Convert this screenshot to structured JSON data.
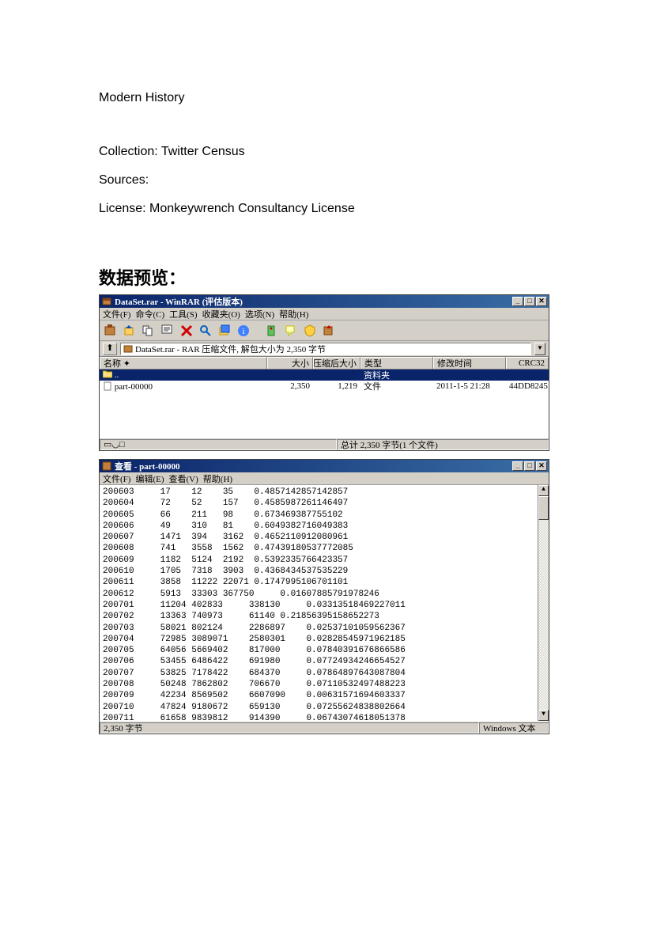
{
  "doc": {
    "title": "Modern History",
    "collection": "Collection: Twitter Census",
    "sources": "Sources:",
    "license": "License: Monkeywrench Consultancy License",
    "preview_heading": "数据预览："
  },
  "winrar": {
    "title": "DataSet.rar - WinRAR (评估版本)",
    "menu": [
      "文件(F)",
      "命令(C)",
      "工具(S)",
      "收藏夹(O)",
      "选项(N)",
      "帮助(H)"
    ],
    "addr": "DataSet.rar - RAR 压缩文件, 解包大小为 2,350 字节",
    "columns": [
      "名称 ✦",
      "大小",
      "压缩后大小",
      "类型",
      "修改时间",
      "CRC32"
    ],
    "rows": [
      {
        "name": "..",
        "size": "",
        "comp": "",
        "type": "资料夹",
        "date": "",
        "crc": "",
        "selected": true,
        "icon": "folder"
      },
      {
        "name": "part-00000",
        "size": "2,350",
        "comp": "1,219",
        "type": "文件",
        "date": "2011-1-5 21:28",
        "crc": "44DD8245",
        "selected": false,
        "icon": "file"
      }
    ],
    "status_left": "▭◡□",
    "status_right": "总计 2,350 字节(1 个文件)"
  },
  "viewer": {
    "title": "查看 - part-00000",
    "menu": [
      "文件(F)",
      "编辑(E)",
      "查看(V)",
      "帮助(H)"
    ],
    "status_left": "2,350 字节",
    "status_right": "Windows 文本",
    "rows": [
      "200603     17    12    35    0.4857142857142857",
      "200604     72    52    157   0.4585987261146497",
      "200605     66    211   98    0.673469387755102",
      "200606     49    310   81    0.6049382716049383",
      "200607     1471  394   3162  0.4652110912080961",
      "200608     741   3558  1562  0.47439180537772085",
      "200609     1182  5124  2192  0.5392335766423357",
      "200610     1705  7318  3903  0.4368434537535229",
      "200611     3858  11222 22071 0.1747995106701101",
      "200612     5913  33303 367750     0.01607885791978246",
      "200701     11204 402833     338130     0.03313518469227011",
      "200702     13363 740973     61140 0.21856395158652273",
      "200703     58021 802124     2286897    0.02537101059562367",
      "200704     72985 3089071    2580301    0.02828545971962185",
      "200705     64056 5669402    817000     0.07840391676866586",
      "200706     53455 6486422    691980     0.07724934246654527",
      "200707     53825 7178422    684370     0.07864897643087804",
      "200708     50248 7862802    706670     0.07110532497488223",
      "200709     42234 8569502    6607090    0.00631571694603337",
      "200710     47824 9180672    659130     0.07255624838802664",
      "200711     61658 9839812    914390     0.06743074618051378"
    ]
  }
}
